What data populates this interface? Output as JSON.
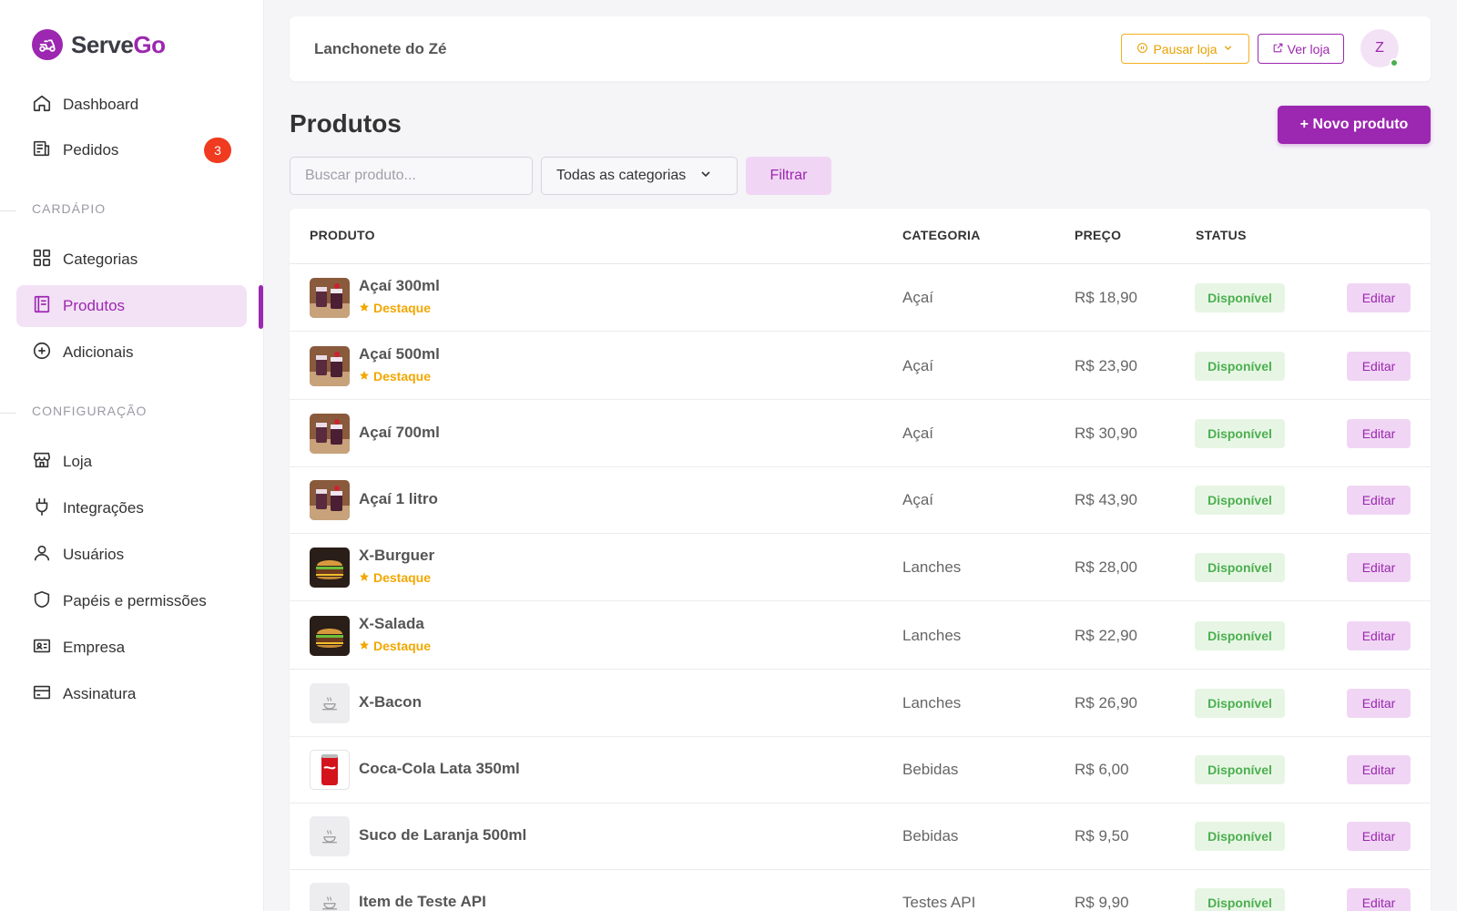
{
  "brand": {
    "name_part1": "Serve",
    "name_part2": "Go"
  },
  "colors": {
    "accent": "#9c27b0",
    "accent_light": "#f3e2f6",
    "warning": "#f2a700",
    "success": "#4caf50",
    "badge": "#f03b20"
  },
  "sidebar": {
    "main": [
      {
        "label": "Dashboard",
        "icon": "home-icon"
      },
      {
        "label": "Pedidos",
        "icon": "receipt-icon",
        "badge": "3"
      }
    ],
    "section_menu": "CARDÁPIO",
    "menu": [
      {
        "label": "Categorias",
        "icon": "grid-icon"
      },
      {
        "label": "Produtos",
        "icon": "book-icon",
        "active": true
      },
      {
        "label": "Adicionais",
        "icon": "plus-circle-icon"
      }
    ],
    "section_config": "CONFIGURAÇÃO",
    "config": [
      {
        "label": "Loja",
        "icon": "store-icon"
      },
      {
        "label": "Integrações",
        "icon": "plug-icon"
      },
      {
        "label": "Usuários",
        "icon": "user-icon"
      },
      {
        "label": "Papéis e permissões",
        "icon": "shield-icon"
      },
      {
        "label": "Empresa",
        "icon": "id-card-icon"
      },
      {
        "label": "Assinatura",
        "icon": "credit-card-icon"
      }
    ]
  },
  "header": {
    "store_name": "Lanchonete do Zé",
    "pause_label": "Pausar loja",
    "view_label": "Ver loja",
    "avatar_initial": "Z"
  },
  "page": {
    "title": "Produtos",
    "new_button": "+ Novo produto",
    "search_placeholder": "Buscar produto...",
    "category_select": "Todas as categorias",
    "filter_button": "Filtrar"
  },
  "table": {
    "columns": [
      "PRODUTO",
      "CATEGORIA",
      "PREÇO",
      "STATUS"
    ],
    "edit_label": "Editar",
    "featured_label": "Destaque",
    "rows": [
      {
        "name": "Açaí 300ml",
        "featured": true,
        "category": "Açaí",
        "price": "R$ 18,90",
        "status": "Disponível",
        "image": "acai"
      },
      {
        "name": "Açaí 500ml",
        "featured": true,
        "category": "Açaí",
        "price": "R$ 23,90",
        "status": "Disponível",
        "image": "acai"
      },
      {
        "name": "Açaí 700ml",
        "featured": false,
        "category": "Açaí",
        "price": "R$ 30,90",
        "status": "Disponível",
        "image": "acai"
      },
      {
        "name": "Açaí 1 litro",
        "featured": false,
        "category": "Açaí",
        "price": "R$ 43,90",
        "status": "Disponível",
        "image": "acai"
      },
      {
        "name": "X-Burguer",
        "featured": true,
        "category": "Lanches",
        "price": "R$ 28,00",
        "status": "Disponível",
        "image": "burger"
      },
      {
        "name": "X-Salada",
        "featured": true,
        "category": "Lanches",
        "price": "R$ 22,90",
        "status": "Disponível",
        "image": "burger"
      },
      {
        "name": "X-Bacon",
        "featured": false,
        "category": "Lanches",
        "price": "R$ 26,90",
        "status": "Disponível",
        "image": "placeholder"
      },
      {
        "name": "Coca-Cola Lata 350ml",
        "featured": false,
        "category": "Bebidas",
        "price": "R$ 6,00",
        "status": "Disponível",
        "image": "can"
      },
      {
        "name": "Suco de Laranja 500ml",
        "featured": false,
        "category": "Bebidas",
        "price": "R$ 9,50",
        "status": "Disponível",
        "image": "placeholder"
      },
      {
        "name": "Item de Teste API",
        "featured": false,
        "category": "Testes API",
        "price": "R$ 9,90",
        "status": "Disponível",
        "image": "placeholder"
      }
    ]
  }
}
